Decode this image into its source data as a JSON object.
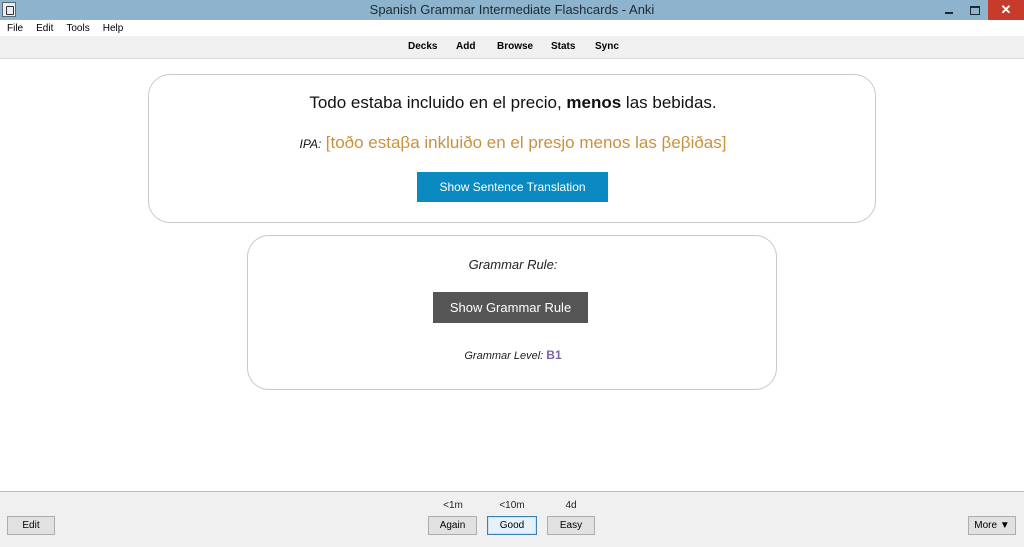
{
  "window": {
    "title": "Spanish Grammar Intermediate Flashcards - Anki",
    "minimize_symbol": "",
    "maximize_symbol": "",
    "close_symbol": "✕"
  },
  "menu": {
    "items": [
      "File",
      "Edit",
      "Tools",
      "Help"
    ]
  },
  "toolbar": {
    "decks": "Decks",
    "add": "Add",
    "browse": "Browse",
    "stats": "Stats",
    "sync": "Sync"
  },
  "card": {
    "sentence_before": "Todo estaba incluido en el precio, ",
    "sentence_bold": "menos",
    "sentence_after": " las bebidas.",
    "ipa_label": "IPA:",
    "ipa_text": "[toðo estaβa inkluiðo en el presjo menos las βeβiðas]",
    "show_translation_label": "Show Sentence Translation",
    "grammar_rule_label": "Grammar Rule:",
    "show_grammar_label": "Show Grammar Rule",
    "grammar_level_label": "Grammar Level:",
    "grammar_level_value": "B1"
  },
  "answer_bar": {
    "edit_label": "Edit",
    "again_label": "Again",
    "again_interval": "<1m",
    "good_label": "Good",
    "good_interval": "<10m",
    "easy_label": "Easy",
    "easy_interval": "4d",
    "more_label": "More ▼"
  },
  "colors": {
    "titlebar": "#8eb3cc",
    "ipa": "#c9913f",
    "translation_button": "#0b8ac1",
    "grammar_button": "#555555",
    "level_value": "#7a64a8",
    "close_button": "#c73b2b"
  }
}
